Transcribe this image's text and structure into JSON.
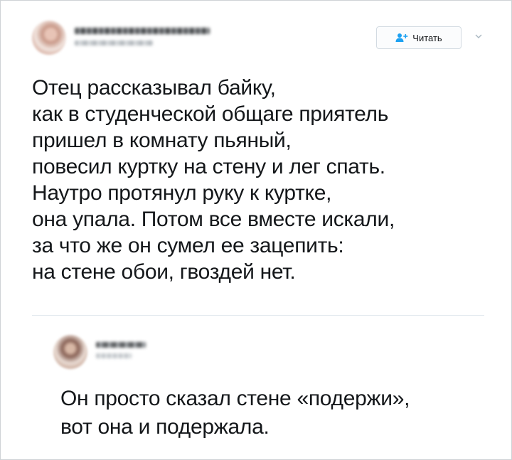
{
  "tweet": {
    "follow_label": "Читать",
    "text_lines": [
      "Отец рассказывал байку,",
      "как в студенческой общаге приятель",
      "пришел в комнату пьяный,",
      "повесил куртку на стену и лег спать.",
      "Наутро протянул руку к куртке,",
      "она упала. Потом все вместе искали,",
      "за что же он сумел ее зацепить:",
      "на стене обои, гвоздей нет."
    ]
  },
  "reply": {
    "text_lines": [
      "Он просто сказал стене «подержи»,",
      "вот она и подержала."
    ]
  },
  "colors": {
    "accent": "#1da1f2",
    "text": "#14171a",
    "divider": "#e1e8ed"
  },
  "icons": {
    "follow": "person-add-icon",
    "caret": "chevron-down-icon"
  }
}
